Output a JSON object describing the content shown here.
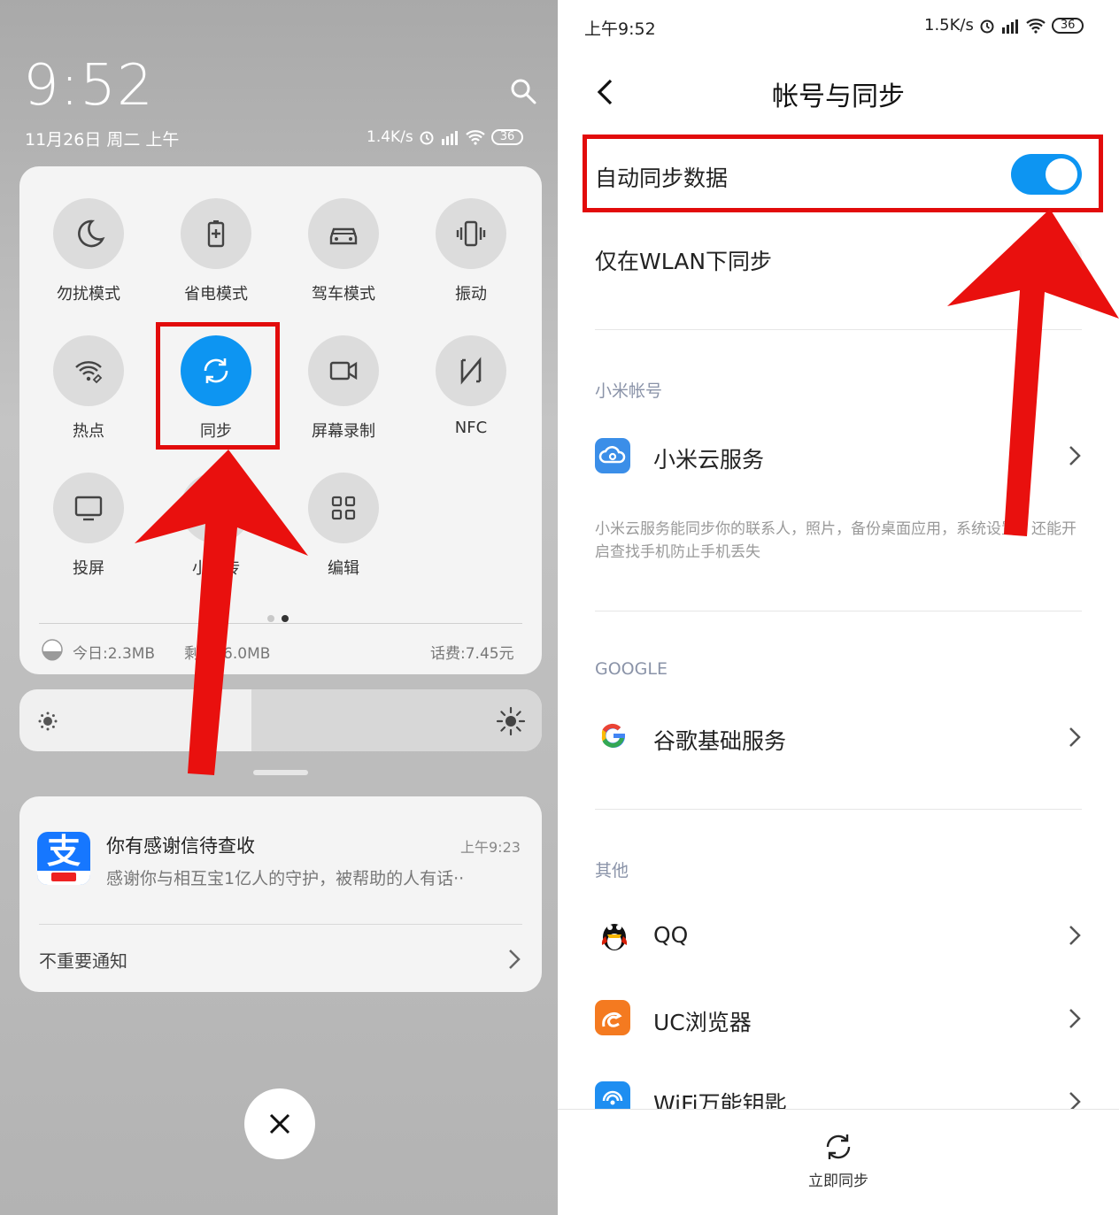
{
  "left": {
    "clock": "9:52",
    "date": "11月26日 周二 上午",
    "status": {
      "speed": "1.4K/s",
      "battery": "36"
    },
    "quick_settings": [
      {
        "label": "勿扰模式",
        "icon": "moon-icon",
        "active": false
      },
      {
        "label": "省电模式",
        "icon": "battery-saver-icon",
        "active": false
      },
      {
        "label": "驾车模式",
        "icon": "car-icon",
        "active": false
      },
      {
        "label": "振动",
        "icon": "vibrate-icon",
        "active": false
      },
      {
        "label": "热点",
        "icon": "hotspot-icon",
        "active": false
      },
      {
        "label": "同步",
        "icon": "sync-icon",
        "active": true
      },
      {
        "label": "屏幕录制",
        "icon": "screen-record-icon",
        "active": false
      },
      {
        "label": "NFC",
        "icon": "nfc-icon",
        "active": false
      },
      {
        "label": "投屏",
        "icon": "cast-icon",
        "active": false
      },
      {
        "label": "小米传",
        "icon": "share-icon",
        "active": false
      },
      {
        "label": "编辑",
        "icon": "edit-grid-icon",
        "active": false
      }
    ],
    "data_usage": {
      "today": "今日:2.3MB",
      "remaining": "剩 646.0MB",
      "balance": "话费:7.45元"
    },
    "notification": {
      "title": "你有感谢信待查收",
      "time": "上午9:23",
      "body": "感谢你与相互宝1亿人的守护，被帮助的人有话··",
      "unimportant": "不重要通知"
    }
  },
  "right": {
    "status": {
      "time": "上午9:52",
      "speed": "1.5K/s",
      "battery": "36"
    },
    "title": "帐号与同步",
    "auto_sync_label": "自动同步数据",
    "auto_sync_on": true,
    "wlan_only_label": "仅在WLAN下同步",
    "wlan_only_on": false,
    "section_mi": "小米帐号",
    "mi_cloud": "小米云服务",
    "mi_cloud_desc": "小米云服务能同步你的联系人，照片，备份桌面应用，系统设置，还能开启查找手机防止手机丢失",
    "section_google": "GOOGLE",
    "google_services": "谷歌基础服务",
    "section_other": "其他",
    "other_apps": [
      "QQ",
      "UC浏览器",
      "WiFi万能钥匙"
    ],
    "sync_now": "立即同步"
  },
  "colors": {
    "accent": "#0d95f2",
    "annotation": "#e20b0b"
  }
}
